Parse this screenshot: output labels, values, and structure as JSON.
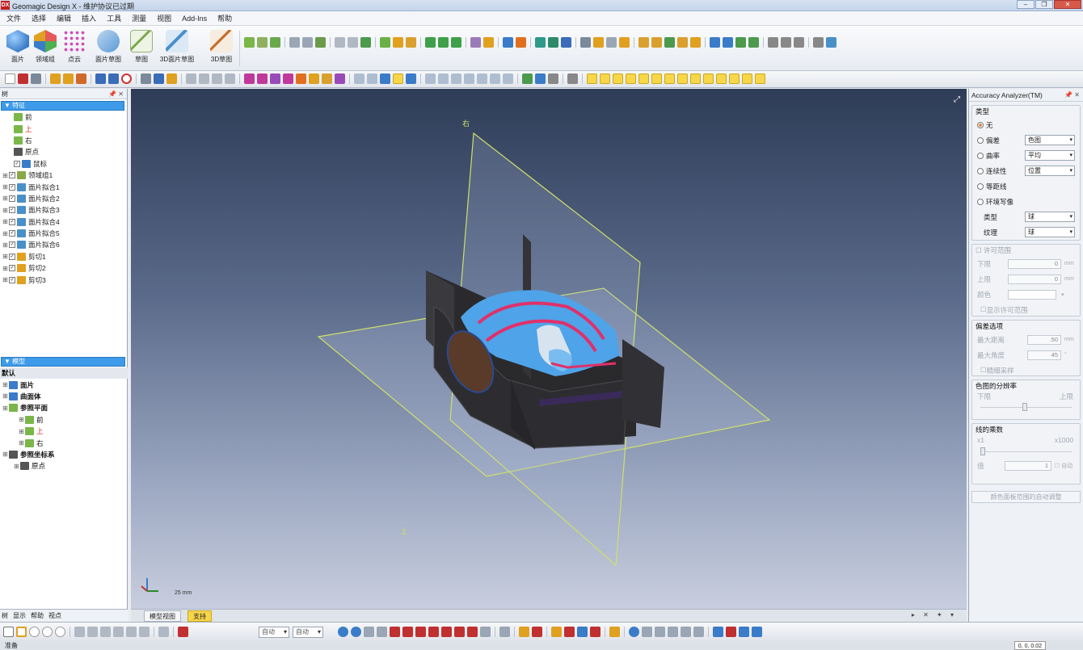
{
  "window": {
    "title": "Geomagic Design X - 维护协议已过期",
    "logo": "DX",
    "controls": [
      "–",
      "❐",
      "✕"
    ]
  },
  "menu": [
    "文件",
    "选择",
    "编辑",
    "插入",
    "工具",
    "测量",
    "视图",
    "Add-Ins",
    "帮助"
  ],
  "ribbon": {
    "big_buttons": [
      {
        "label": "面片",
        "icon": "mesh-icon",
        "color": "#4c8fd6"
      },
      {
        "label": "领域组",
        "icon": "region-group-icon",
        "color": "#e05a8c"
      },
      {
        "label": "点云",
        "icon": "point-cloud-icon",
        "color": "#d04ab4"
      },
      {
        "label": "面片草图",
        "icon": "mesh-sketch-icon",
        "color": "#5b9ad6"
      },
      {
        "label": "草图",
        "icon": "sketch-icon",
        "color": "#7aa84c"
      },
      {
        "label": "3D面片草图",
        "icon": "3d-mesh-sketch-icon",
        "color": "#4a90c8"
      },
      {
        "label": "3D草图",
        "icon": "3d-sketch-icon",
        "color": "#c86c2a"
      }
    ]
  },
  "colors": {
    "accent": "#3d9be9",
    "highlight": "#f7d64a",
    "plane": "#cfe06a",
    "viewport_top": "#2e3c57",
    "viewport_bottom": "#c8cede"
  },
  "feature_tree": {
    "panel_title": "树",
    "header": "特征",
    "items": [
      {
        "label": "前",
        "icon": "plane-icon",
        "color": "#222",
        "indent": 1,
        "check": false
      },
      {
        "label": "上",
        "icon": "plane-icon",
        "color": "#d41f1f",
        "indent": 1,
        "check": false
      },
      {
        "label": "右",
        "icon": "plane-icon",
        "color": "#222",
        "indent": 1,
        "check": false
      },
      {
        "label": "原点",
        "icon": "origin-icon",
        "color": "#222",
        "indent": 1,
        "check": false
      },
      {
        "label": "鼠标",
        "icon": "mesh-icon",
        "color": "#222",
        "indent": 1,
        "check": true
      },
      {
        "label": "领域组1",
        "icon": "region-icon",
        "color": "#222",
        "indent": 0,
        "check": true
      },
      {
        "label": "面片拟合1",
        "icon": "fit-icon",
        "color": "#222",
        "indent": 0,
        "check": true
      },
      {
        "label": "面片拟合2",
        "icon": "fit-icon",
        "color": "#222",
        "indent": 0,
        "check": true
      },
      {
        "label": "面片拟合3",
        "icon": "fit-icon",
        "color": "#222",
        "indent": 0,
        "check": true
      },
      {
        "label": "面片拟合4",
        "icon": "fit-icon",
        "color": "#222",
        "indent": 0,
        "check": true
      },
      {
        "label": "面片拟合5",
        "icon": "fit-icon",
        "color": "#222",
        "indent": 0,
        "check": true
      },
      {
        "label": "面片拟合6",
        "icon": "fit-icon",
        "color": "#222",
        "indent": 0,
        "check": true
      },
      {
        "label": "剪切1",
        "icon": "cut-icon",
        "color": "#222",
        "indent": 0,
        "check": true
      },
      {
        "label": "剪切2",
        "icon": "cut-icon",
        "color": "#222",
        "indent": 0,
        "check": true
      },
      {
        "label": "剪切3",
        "icon": "cut-icon",
        "color": "#222",
        "indent": 0,
        "check": true
      }
    ]
  },
  "model_tree": {
    "header": "模型",
    "items": [
      {
        "label": "默认",
        "bold": true
      },
      {
        "label": "面片",
        "bold": true
      },
      {
        "label": "曲面体",
        "bold": true
      },
      {
        "label": "参照平面",
        "bold": true
      },
      {
        "label": "前",
        "bold": false
      },
      {
        "label": "上",
        "bold": false
      },
      {
        "label": "右",
        "bold": false
      },
      {
        "label": "参照坐标系",
        "bold": true
      },
      {
        "label": "原点",
        "bold": false
      }
    ]
  },
  "left_tabs": [
    "树",
    "显示",
    "帮助",
    "视点"
  ],
  "viewport": {
    "plane_labels": [
      "右",
      "上"
    ],
    "scale": "25 mm",
    "tabs": [
      "模型视图",
      "支持"
    ]
  },
  "accuracy": {
    "title": "Accuracy Analyzer(TM)",
    "type_group": "类型",
    "options": [
      {
        "label": "无",
        "selected": true,
        "select": ""
      },
      {
        "label": "偏差",
        "selected": false,
        "select": "色图"
      },
      {
        "label": "曲率",
        "selected": false,
        "select": "平均"
      },
      {
        "label": "连续性",
        "selected": false,
        "select": "位置"
      },
      {
        "label": "等距线",
        "selected": false,
        "select": ""
      },
      {
        "label": "环境写像",
        "selected": false,
        "select": ""
      }
    ],
    "type_label": "类型",
    "type_value": "球",
    "texture_label": "纹理",
    "texture_value": "球",
    "tolerance_group": "许可范围",
    "lower_label": "下限",
    "lower_value": "0",
    "upper_label": "上限",
    "upper_value": "0",
    "color_label": "颜色",
    "show_tolerance": "显示许可范围",
    "unit_mm": "mm",
    "deviation_group": "偏差选项",
    "max_dist_label": "最大距离",
    "max_dist_value": ".50",
    "max_angle_label": "最大角度",
    "max_angle_value": "45",
    "degree": "°",
    "sample_label": "精细采样",
    "resolution_group": "色图的分辨率",
    "res_low": "下限",
    "res_high": "上限",
    "line_group": "线的乘数",
    "x1": "x1",
    "x1000": "x1000",
    "value_label": "值",
    "value": "1",
    "auto": "自动",
    "auto_button": "颜色面板范围的自动调整"
  },
  "bottom": {
    "combo1": "自动",
    "combo2": "自动"
  },
  "status": {
    "text": "准备",
    "coords": "0, 0, 0.02"
  }
}
